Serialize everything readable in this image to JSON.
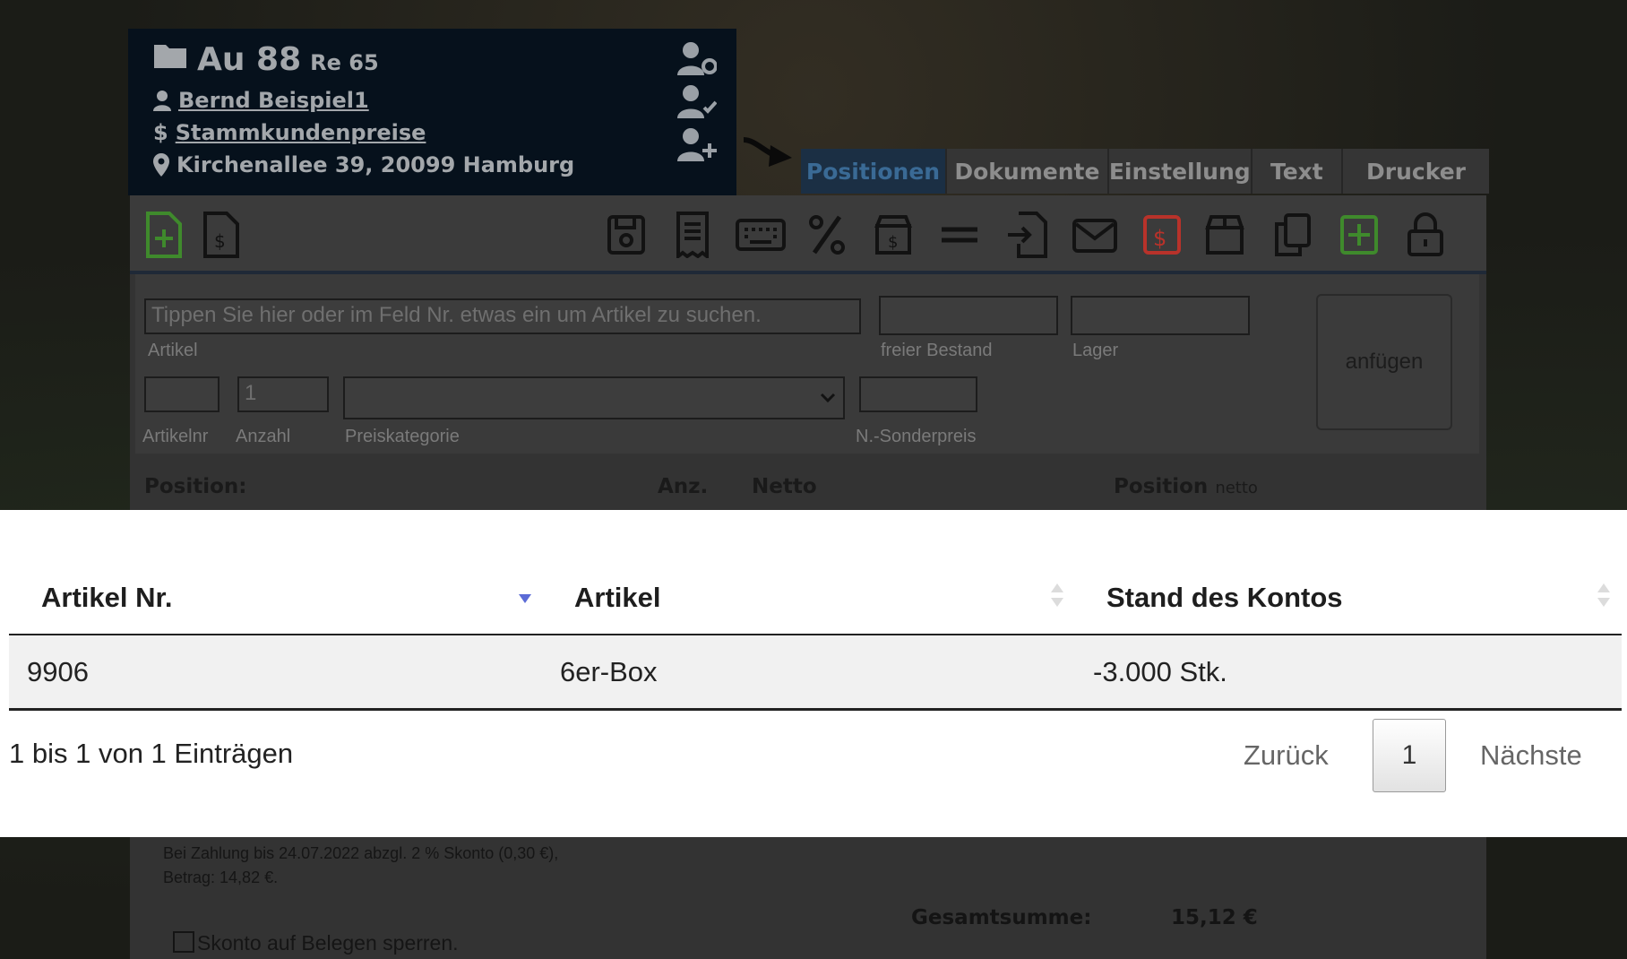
{
  "header": {
    "doc_number": "Au 88",
    "doc_sub": "Re 65",
    "customer": "Bernd Beispiel1",
    "price_group": "Stammkundenpreise",
    "address": "Kirchenallee 39, 20099 Hamburg"
  },
  "tabs": [
    {
      "label": "Positionen",
      "active": true
    },
    {
      "label": "Dokumente",
      "active": false
    },
    {
      "label": "Einstellung",
      "active": false
    },
    {
      "label": "Text",
      "active": false
    },
    {
      "label": "Drucker",
      "active": false
    }
  ],
  "form": {
    "article_placeholder": "Tippen Sie hier oder im Feld Nr. etwas ein um Artikel zu suchen.",
    "article_label": "Artikel",
    "stock_label": "freier Bestand",
    "warehouse_label": "Lager",
    "artnr_label": "Artikelnr",
    "qty_label": "Anzahl",
    "qty_value": "1",
    "price_cat_label": "Preiskategorie",
    "special_price_label": "N.-Sonderpreis",
    "add_button": "anfügen"
  },
  "positions_header": {
    "position": "Position:",
    "qty": "Anz.",
    "net": "Netto",
    "position_total": "Position",
    "position_total_suffix": "netto"
  },
  "lookup_table": {
    "columns": [
      "Artikel Nr.",
      "Artikel",
      "Stand des Kontos"
    ],
    "rows": [
      [
        "9906",
        "6er-Box",
        "-3.000 Stk."
      ]
    ],
    "info": "1 bis 1 von 1 Einträgen",
    "prev": "Zurück",
    "page": "1",
    "next": "Nächste"
  },
  "footer": {
    "skonto_line1": "Bei Zahlung bis 24.07.2022 abzgl. 2 % Skonto (0,30 €),",
    "skonto_line2": "Betrag: 14,82 €.",
    "lock_skonto": "Skonto auf Belegen sperren.",
    "total_label": "Gesamtsumme:",
    "total_value": "15,12 €"
  },
  "colors": {
    "active_tab": "#1b2f44",
    "sort_active": "#5b6bd6",
    "icon_green": "#3f8a2c",
    "icon_red": "#b8322a"
  }
}
